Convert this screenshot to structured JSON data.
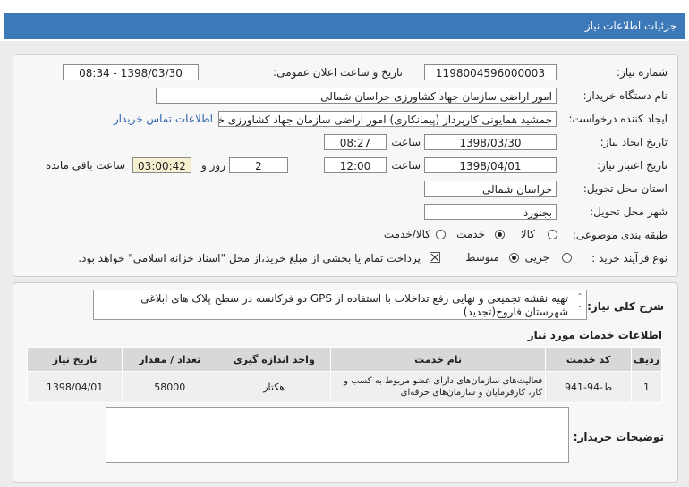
{
  "window": {
    "title": "جزئیات اطلاعات نیاز"
  },
  "form": {
    "need_number_label": "شماره نیاز:",
    "need_number": "1198004596000003",
    "announce_label": "تاریخ و ساعت اعلان عمومی:",
    "announce_value": "1398/03/30 - 08:34",
    "buyer_org_label": "نام دستگاه خریدار:",
    "buyer_org": "امور اراضی سازمان جهاد کشاورزی خراسان شمالی",
    "requester_label": "ایجاد کننده درخواست:",
    "requester": "جمشید همایونی کارپرداز (پیمانکاری) امور اراضی سازمان جهاد کشاورزی خراسان شمالی",
    "contact_link": "اطلاعات تماس خریدار",
    "create_date_label": "تاریخ ایجاد نیاز:",
    "create_date": "1398/03/30",
    "time_label": "ساعت",
    "create_time": "08:27",
    "valid_date_label": "تاریخ اعتبار نیاز:",
    "valid_date": "1398/04/01",
    "valid_time": "12:00",
    "days": "2",
    "day_label": "روز و",
    "remaining_time": "03:00:42",
    "remaining_label": "ساعت باقی مانده",
    "province_label": "استان محل تحویل:",
    "province": "خراسان شمالی",
    "city_label": "شهر محل تحویل:",
    "city": "بجنورد",
    "category_label": "طبقه بندی موضوعی:",
    "category_options": [
      "کالا",
      "خدمت",
      "کالا/خدمت"
    ],
    "category_selected": "خدمت",
    "process_label": "نوع فرآیند خرید :",
    "process_options": [
      "جزیی",
      "متوسط"
    ],
    "process_selected": "متوسط",
    "payment_note": "پرداخت تمام یا بخشی از مبلغ خرید،از محل \"اسناد خزانه اسلامی\" خواهد بود."
  },
  "general_desc": {
    "label": "شرح کلی نیاز:",
    "text": "تهیه نقشه تجمیعی و نهایی رفع تداخلات با استفاده از GPS دو فرکانسه در سطح پلاک های ابلاغی شهرستان فاروج(تجدید)"
  },
  "services": {
    "title": "اطلاعات خدمات مورد نیاز",
    "headers": [
      "ردیف",
      "کد خدمت",
      "نام خدمت",
      "واحد اندازه گیری",
      "تعداد / مقدار",
      "تاریخ نیاز"
    ],
    "rows": [
      [
        "1",
        "ط-94-941",
        "فعالیت‌های سازمان‌های دارای عضو مربوط به کسب و کار، کارفرمایان و سازمان‌های حرفه‌ای",
        "هکتار",
        "58000",
        "1398/04/01"
      ]
    ]
  },
  "buyer_notes": {
    "label": "توضیحات خریدار:",
    "text": ""
  }
}
